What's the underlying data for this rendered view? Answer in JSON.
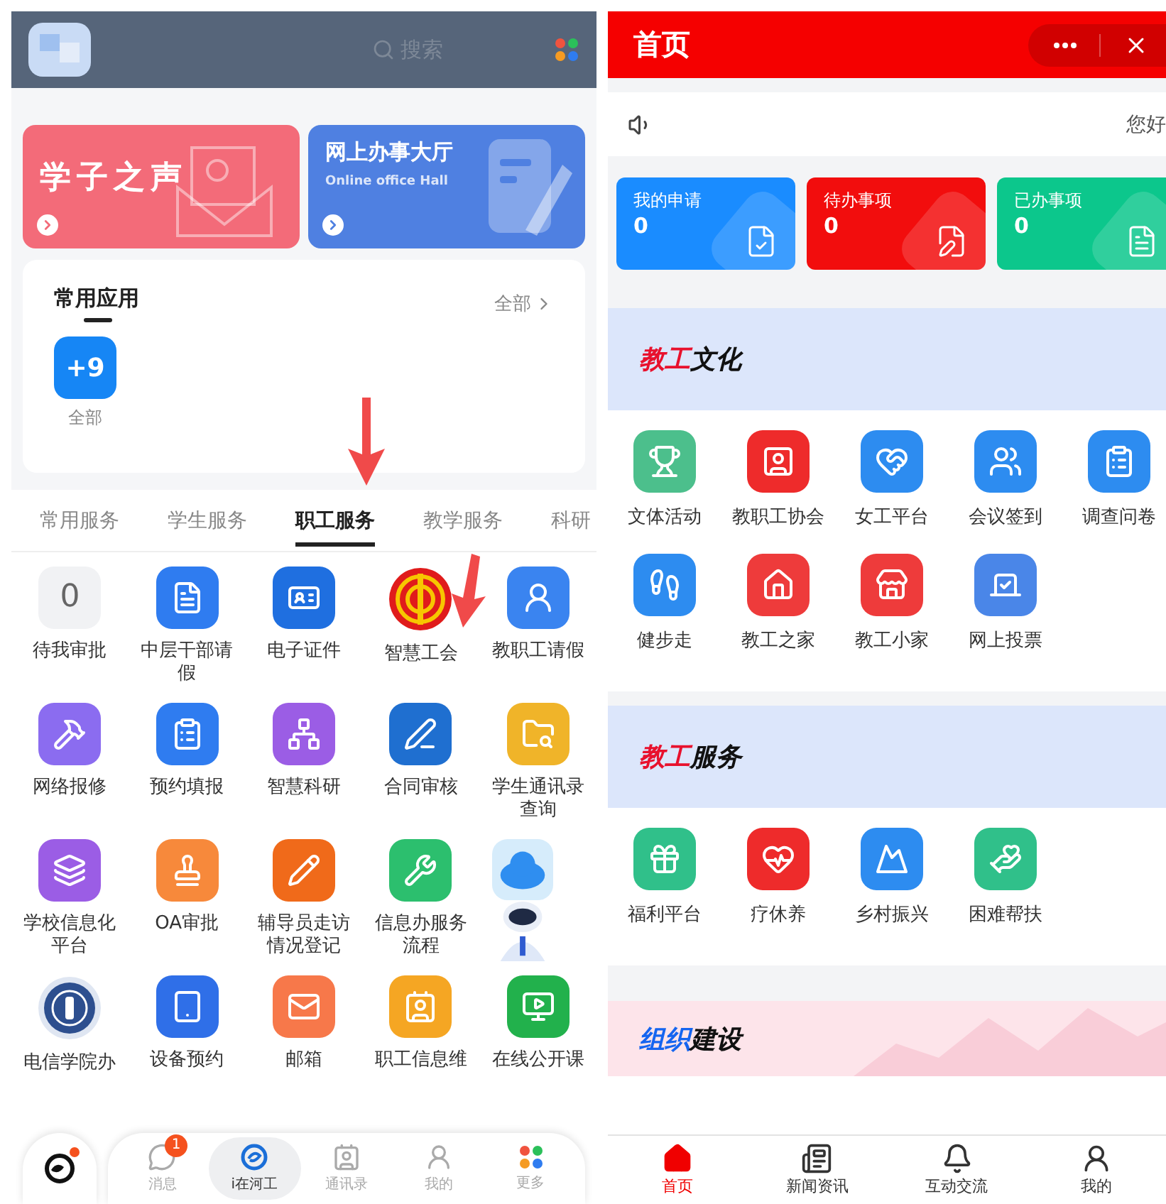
{
  "left_screen": {
    "search": {
      "placeholder": "搜索"
    },
    "banners": [
      {
        "title": "学子之声",
        "color": "#f36b79"
      },
      {
        "title": "网上办事大厅",
        "subtitle": "Online office Hall",
        "color": "#4f80e1"
      }
    ],
    "frequent_apps": {
      "title": "常用应用",
      "more": "全部",
      "tiles": [
        {
          "badge": "+9",
          "label": "全部"
        }
      ]
    },
    "tabs": [
      {
        "label": "常用服务",
        "selected": false
      },
      {
        "label": "学生服务",
        "selected": false
      },
      {
        "label": "职工服务",
        "selected": true
      },
      {
        "label": "教学服务",
        "selected": false
      },
      {
        "label": "科研",
        "selected": false
      }
    ],
    "services": [
      {
        "kind": "count",
        "count": "0",
        "label": "待我审批",
        "color": "#f1f2f4"
      },
      {
        "kind": "icon",
        "label": "中层干部请假",
        "color": "#2f7cf0"
      },
      {
        "kind": "icon",
        "label": "电子证件",
        "color": "#1f6fe0"
      },
      {
        "kind": "emblem",
        "label": "智慧工会"
      },
      {
        "kind": "icon",
        "label": "教职工请假",
        "color": "#3a84f0"
      },
      {
        "kind": "icon",
        "label": "网络报修",
        "color": "#8b6cf0"
      },
      {
        "kind": "icon",
        "label": "预约填报",
        "color": "#2f7cf0"
      },
      {
        "kind": "icon",
        "label": "智慧科研",
        "color": "#9b5de5"
      },
      {
        "kind": "icon",
        "label": "合同审核",
        "color": "#1f6fd0"
      },
      {
        "kind": "icon",
        "label": "学生通讯录查询",
        "color": "#f0b429"
      },
      {
        "kind": "icon",
        "label": "学校信息化平台",
        "color": "#9b5de5"
      },
      {
        "kind": "icon",
        "label": "OA审批",
        "color": "#f7893b"
      },
      {
        "kind": "icon",
        "label": "辅导员走访情况登记",
        "color": "#f06a1a"
      },
      {
        "kind": "icon",
        "label": "信息办服务流程",
        "color": "#2cbf6e"
      },
      {
        "kind": "robot"
      },
      {
        "kind": "seal",
        "label": "电信学院办"
      },
      {
        "kind": "icon",
        "label": "设备预约",
        "color": "#2f6fe8"
      },
      {
        "kind": "icon",
        "label": "邮箱",
        "color": "#f7784a"
      },
      {
        "kind": "icon",
        "label": "职工信息维",
        "color": "#f5a623"
      },
      {
        "kind": "icon",
        "label": "在线公开课",
        "color": "#22b14c"
      }
    ],
    "bottom_nav": [
      {
        "label": "消息",
        "badge": "1",
        "selected": false
      },
      {
        "label": "i在河工",
        "selected": true
      },
      {
        "label": "通讯录",
        "selected": false
      },
      {
        "label": "我的",
        "selected": false
      },
      {
        "label": "更多",
        "selected": false
      }
    ]
  },
  "right_screen": {
    "title": "首页",
    "notice": "您好",
    "stats": [
      {
        "label": "我的申请",
        "count": "0",
        "color": "#1a8cff"
      },
      {
        "label": "待办事项",
        "count": "0",
        "color": "#f20d0d"
      },
      {
        "label": "已办事项",
        "count": "0",
        "color": "#0cc78c"
      }
    ],
    "sections": [
      {
        "title_accent": "教工",
        "title_rest": "文化",
        "color": "#e8112d",
        "kind": "plain",
        "items": [
          {
            "label": "文体活动",
            "color": "#4cbf8c"
          },
          {
            "label": "教职工协会",
            "color": "#ee2b2b"
          },
          {
            "label": "女工平台",
            "color": "#2d8cf0"
          },
          {
            "label": "会议签到",
            "color": "#2d8cf0"
          },
          {
            "label": "调查问卷",
            "color": "#2d8cf0"
          },
          {
            "label": "健步走",
            "color": "#2d8cf0"
          },
          {
            "label": "教工之家",
            "color": "#ee3b3b"
          },
          {
            "label": "教工小家",
            "color": "#ee3b3b"
          },
          {
            "label": "网上投票",
            "color": "#4a86e8"
          }
        ]
      },
      {
        "title_accent": "教工",
        "title_rest": "服务",
        "color": "#e8112d",
        "kind": "plain",
        "items": [
          {
            "label": "福利平台",
            "color": "#30c08a"
          },
          {
            "label": "疗休养",
            "color": "#ee2b2b"
          },
          {
            "label": "乡村振兴",
            "color": "#2d8cf0"
          },
          {
            "label": "困难帮扶",
            "color": "#30c08a"
          }
        ]
      },
      {
        "title_accent": "组织",
        "title_rest": "建设",
        "color": "#1565f0",
        "kind": "scenic"
      }
    ],
    "bottom_nav": [
      {
        "label": "首页",
        "selected": true
      },
      {
        "label": "新闻资讯",
        "selected": false
      },
      {
        "label": "互动交流",
        "selected": false
      },
      {
        "label": "我的",
        "selected": false
      }
    ]
  }
}
